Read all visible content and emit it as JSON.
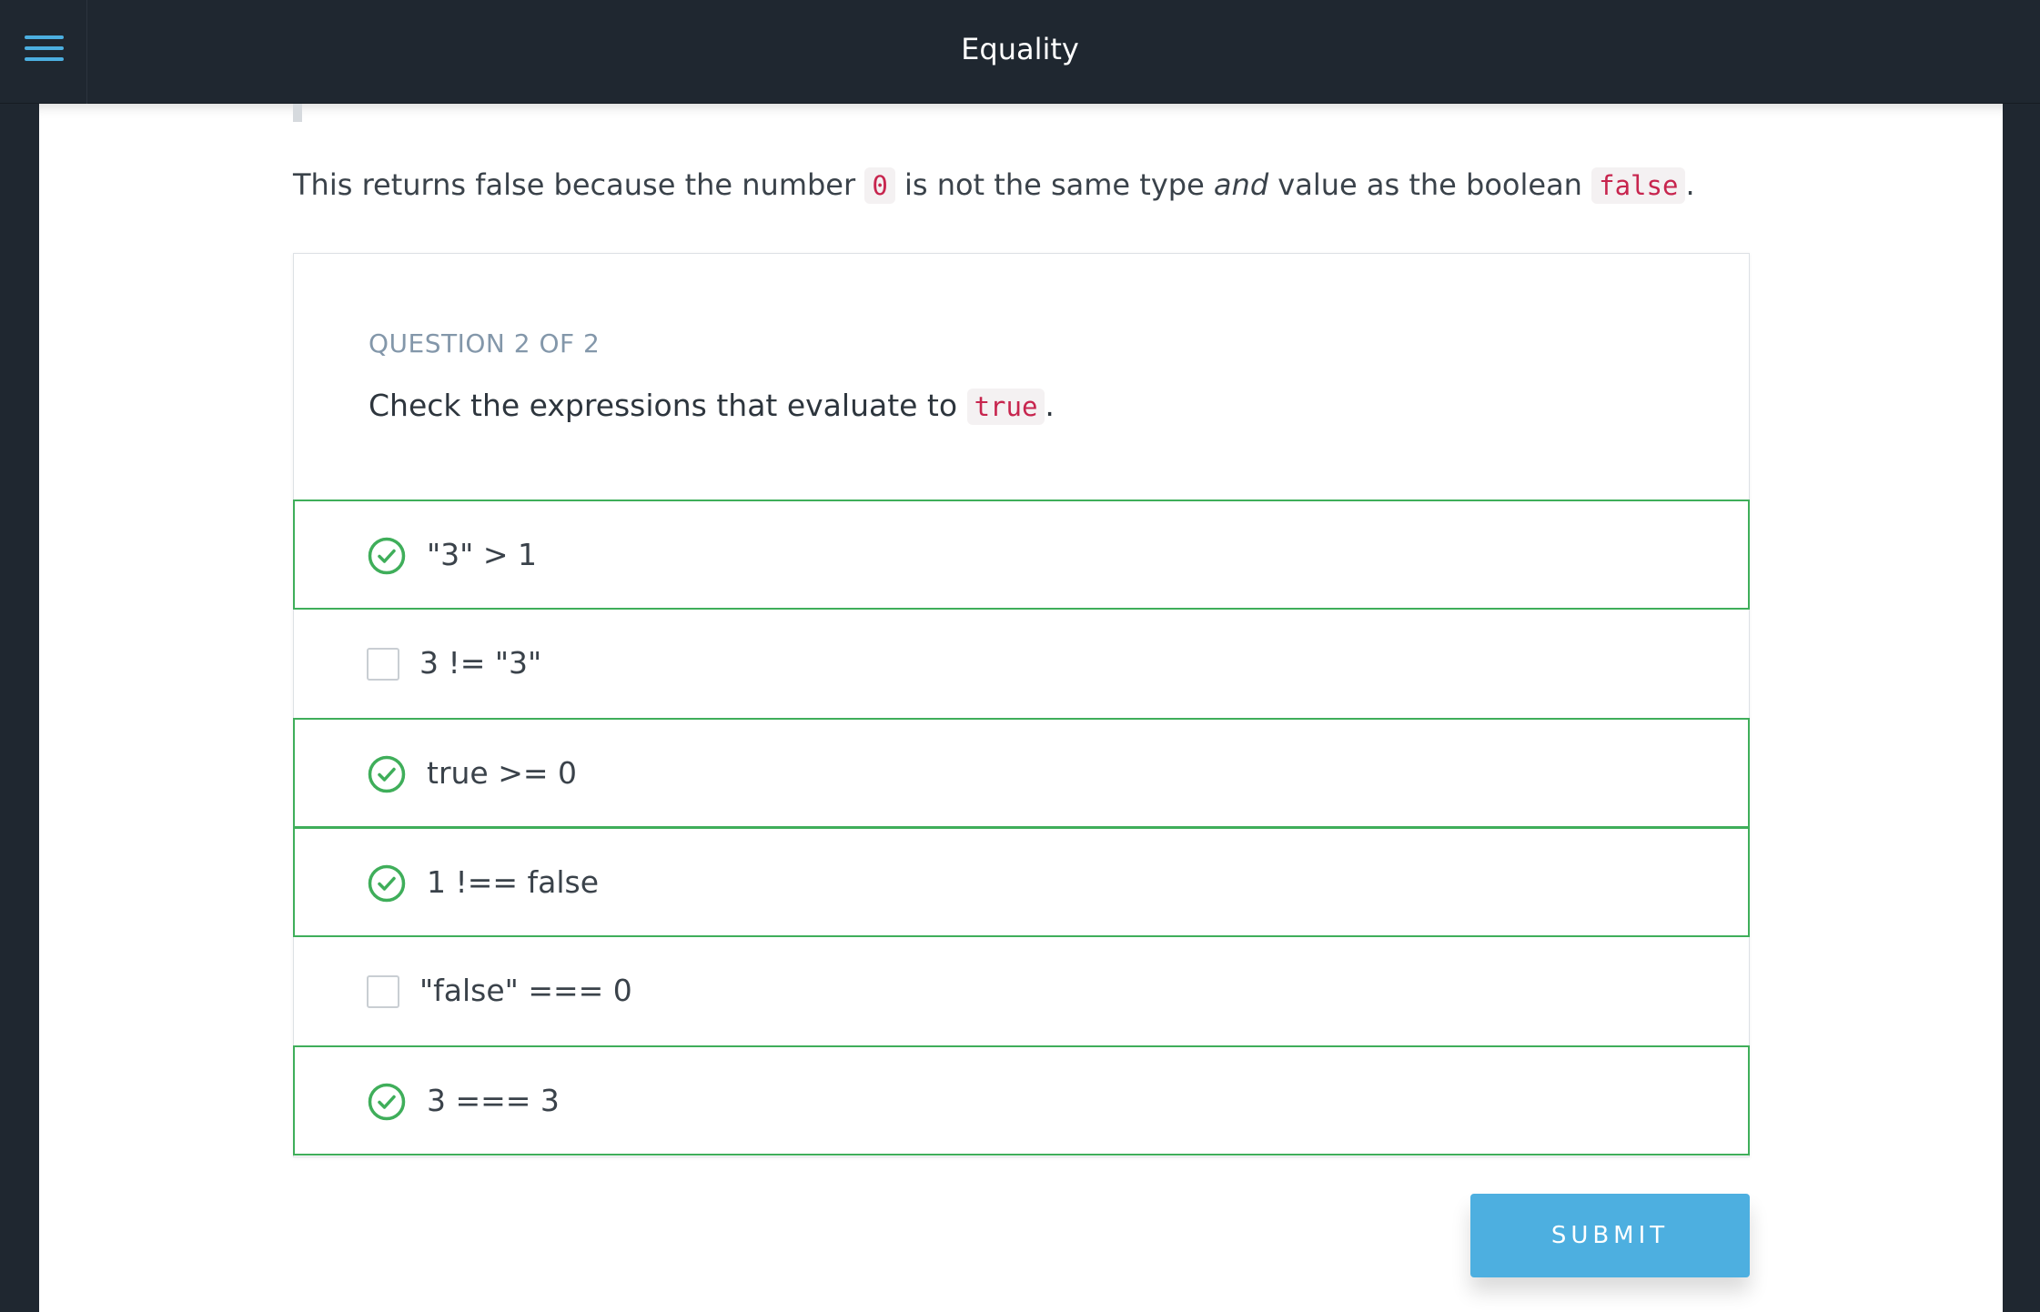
{
  "header": {
    "title": "Equality",
    "menu_icon": "hamburger-menu-icon"
  },
  "intro": {
    "part1": "This returns false because the number ",
    "code1": "0",
    "part2": " is not the same type ",
    "emphasis": "and",
    "part3": " value as the boolean ",
    "code2": "false",
    "part4": "."
  },
  "quiz": {
    "label": "QUESTION 2 OF 2",
    "question_prefix": "Check the expressions that evaluate to ",
    "question_code": "true",
    "question_suffix": ".",
    "options": [
      {
        "label": "\"3\" > 1",
        "selected": true
      },
      {
        "label": "3 != \"3\"",
        "selected": false
      },
      {
        "label": "true >= 0",
        "selected": true
      },
      {
        "label": "1 !== false",
        "selected": true
      },
      {
        "label": "\"false\" === 0",
        "selected": false
      },
      {
        "label": "3 === 3",
        "selected": true
      }
    ],
    "submit_label": "SUBMIT"
  },
  "colors": {
    "header_bg": "#1f2730",
    "accent_blue": "#4dafe0",
    "selected_green": "#3fae5a",
    "code_red": "#c7254e"
  }
}
